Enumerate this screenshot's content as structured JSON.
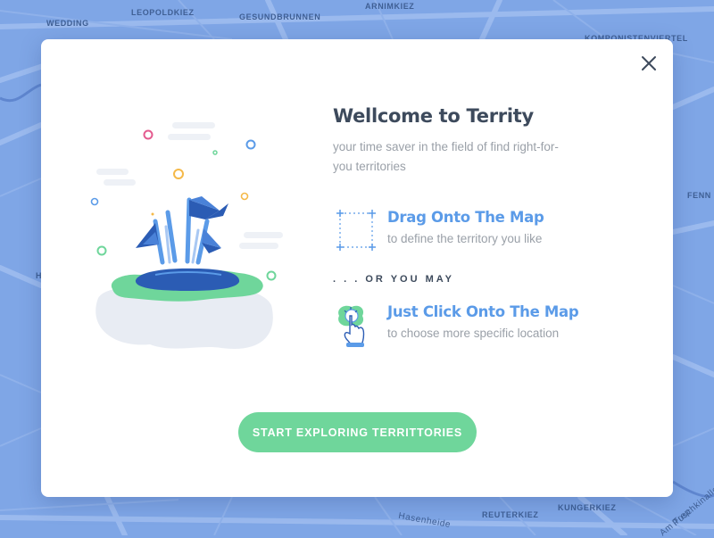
{
  "map": {
    "labels": {
      "wedding": "WEDDING",
      "leopoldkiez": "LEOPOLDKIEZ",
      "gesundbrunnen": "GESUNDBRUNNEN",
      "arnimkiez": "ARNIMKIEZ",
      "komponistenviertel": "KOMPONISTENVIERTEL",
      "fenn": "FENN",
      "h": "H",
      "hasenheide": "Hasenheide",
      "reuterkiez": "REUTERKIEZ",
      "kungerkiez": "KUNGERKIEZ",
      "puschkinallee": "Puschkinalle",
      "amtreptower": "Am Trep"
    }
  },
  "modal": {
    "close_icon": "close-icon",
    "title": "Wellcome to Territy",
    "subtitle": "your time saver in the field of find right-for-you territories",
    "options": [
      {
        "icon": "drag-select-icon",
        "title": "Drag Onto The Map",
        "description": "to define the territory you like"
      },
      {
        "icon": "tap-map-icon",
        "title": "Just Click Onto The Map",
        "description": "to choose more specific location"
      }
    ],
    "separator": ". . .  OR YOU MAY",
    "cta_label": "START EXPLORING TERRITTORIES"
  },
  "colors": {
    "map_background": "#7fa6e6",
    "accent_blue": "#5b9be8",
    "cta_green": "#6fd69b",
    "title_dark": "#3d4a5c",
    "text_muted": "#9aa0a8"
  }
}
